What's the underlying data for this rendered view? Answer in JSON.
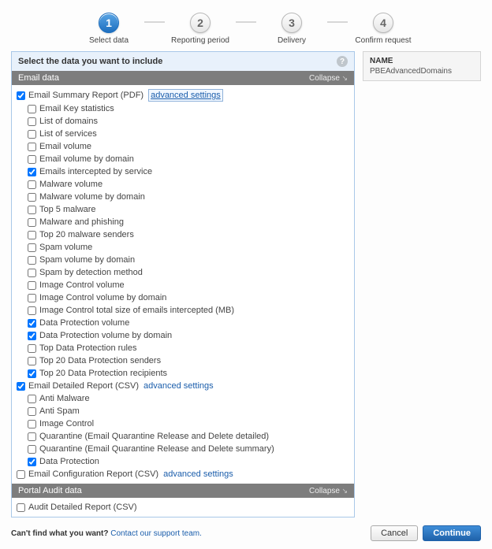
{
  "stepper": {
    "steps": [
      {
        "num": "1",
        "label": "Select data",
        "active": true
      },
      {
        "num": "2",
        "label": "Reporting period",
        "active": false
      },
      {
        "num": "3",
        "label": "Delivery",
        "active": false
      },
      {
        "num": "4",
        "label": "Confirm request",
        "active": false
      }
    ]
  },
  "panel_title": "Select the data you want to include",
  "sidebar": {
    "title": "NAME",
    "value": "PBEAdvancedDomains"
  },
  "sections": {
    "email": {
      "title": "Email data",
      "collapse": "Collapse",
      "items": [
        {
          "label": "Email Summary Report (PDF)",
          "checked": true,
          "indent": 0,
          "adv": "advanced settings",
          "adv_style": "box"
        },
        {
          "label": "Email Key statistics",
          "checked": false,
          "indent": 1
        },
        {
          "label": "List of domains",
          "checked": false,
          "indent": 1
        },
        {
          "label": "List of services",
          "checked": false,
          "indent": 1
        },
        {
          "label": "Email volume",
          "checked": false,
          "indent": 1
        },
        {
          "label": "Email volume by domain",
          "checked": false,
          "indent": 1
        },
        {
          "label": "Emails intercepted by service",
          "checked": true,
          "indent": 1
        },
        {
          "label": "Malware volume",
          "checked": false,
          "indent": 1
        },
        {
          "label": "Malware volume by domain",
          "checked": false,
          "indent": 1
        },
        {
          "label": "Top 5 malware",
          "checked": false,
          "indent": 1
        },
        {
          "label": "Malware and phishing",
          "checked": false,
          "indent": 1
        },
        {
          "label": "Top 20 malware senders",
          "checked": false,
          "indent": 1
        },
        {
          "label": "Spam volume",
          "checked": false,
          "indent": 1
        },
        {
          "label": "Spam volume by domain",
          "checked": false,
          "indent": 1
        },
        {
          "label": "Spam by detection method",
          "checked": false,
          "indent": 1
        },
        {
          "label": "Image Control volume",
          "checked": false,
          "indent": 1
        },
        {
          "label": "Image Control volume by domain",
          "checked": false,
          "indent": 1
        },
        {
          "label": "Image Control total size of emails intercepted (MB)",
          "checked": false,
          "indent": 1
        },
        {
          "label": "Data Protection volume",
          "checked": true,
          "indent": 1
        },
        {
          "label": "Data Protection volume by domain",
          "checked": true,
          "indent": 1
        },
        {
          "label": "Top Data Protection rules",
          "checked": false,
          "indent": 1
        },
        {
          "label": "Top 20 Data Protection senders",
          "checked": false,
          "indent": 1
        },
        {
          "label": "Top 20 Data Protection recipients",
          "checked": true,
          "indent": 1
        },
        {
          "label": "Email Detailed Report (CSV)",
          "checked": true,
          "indent": 0,
          "adv": "advanced settings"
        },
        {
          "label": "Anti Malware",
          "checked": false,
          "indent": 1
        },
        {
          "label": "Anti Spam",
          "checked": false,
          "indent": 1
        },
        {
          "label": "Image Control",
          "checked": false,
          "indent": 1
        },
        {
          "label": "Quarantine (Email Quarantine Release and Delete detailed)",
          "checked": false,
          "indent": 1
        },
        {
          "label": "Quarantine (Email Quarantine Release and Delete summary)",
          "checked": false,
          "indent": 1
        },
        {
          "label": "Data Protection",
          "checked": true,
          "indent": 1
        },
        {
          "label": "Email Configuration Report (CSV)",
          "checked": false,
          "indent": 0,
          "adv": "advanced settings"
        }
      ]
    },
    "portal": {
      "title": "Portal Audit data",
      "collapse": "Collapse",
      "items": [
        {
          "label": "Audit Detailed Report (CSV)",
          "checked": false,
          "indent": 0
        }
      ]
    }
  },
  "footer": {
    "text_prefix": "Can't find what you want? ",
    "link": "Contact our support team.",
    "cancel": "Cancel",
    "continue": "Continue"
  }
}
